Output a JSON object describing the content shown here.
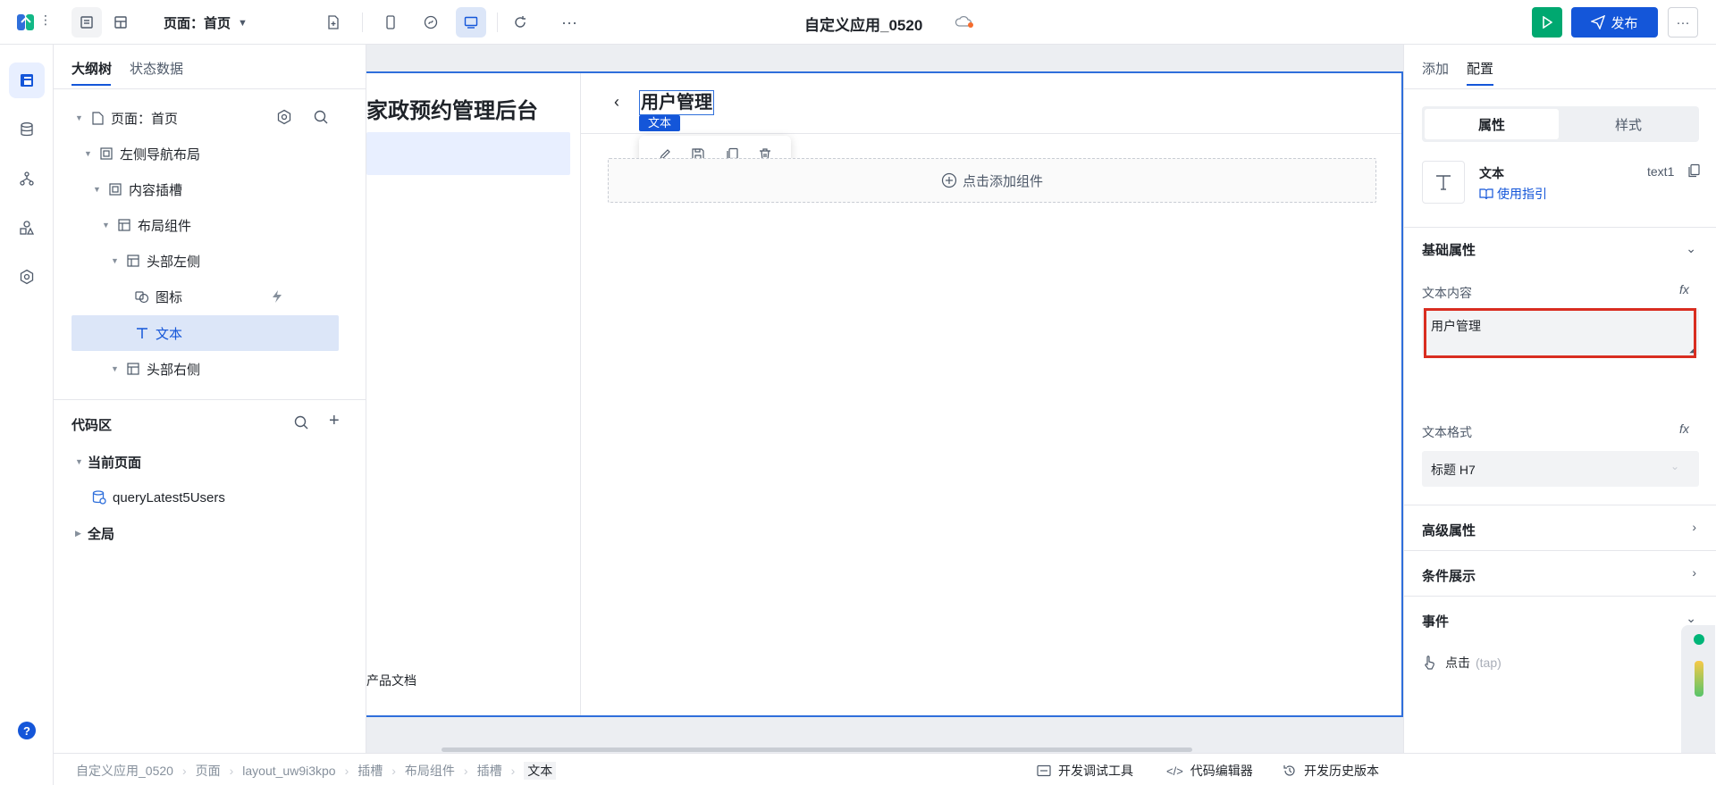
{
  "topbar": {
    "page_selector": "页面：首页",
    "app_title": "自定义应用_0520",
    "publish_label": "发布"
  },
  "outline": {
    "tabs": [
      "大纲树",
      "状态数据"
    ],
    "tree": [
      {
        "label": "页面：首页",
        "level": 0
      },
      {
        "label": "左侧导航布局",
        "level": 1
      },
      {
        "label": "内容插槽",
        "level": 2
      },
      {
        "label": "布局组件",
        "level": 3
      },
      {
        "label": "头部左侧",
        "level": 4
      },
      {
        "label": "图标",
        "level": 5
      },
      {
        "label": "文本",
        "level": 5
      },
      {
        "label": "头部右侧",
        "level": 4
      }
    ],
    "code_area": {
      "title": "代码区",
      "current_page": "当前页面",
      "query": "queryLatest5Users",
      "global": "全局"
    }
  },
  "canvas": {
    "sidebar_title": "家政预约管理后台",
    "sidebar_footer": "产品文档",
    "header_text": "用户管理",
    "selected_tag": "文本",
    "add_component": "点击添加组件"
  },
  "rightpanel": {
    "tabs": [
      "添加",
      "配置"
    ],
    "seg": [
      "属性",
      "样式"
    ],
    "component_name": "文本",
    "component_id": "text1",
    "guide_link": "使用指引",
    "basic_props": "基础属性",
    "text_content_label": "文本内容",
    "text_content_value": "用户管理",
    "text_format_label": "文本格式",
    "text_format_value": "标题 H7",
    "advanced_props": "高级属性",
    "conditional": "条件展示",
    "events": "事件",
    "event_tap": "点击",
    "event_tap_code": "(tap)",
    "fx": "fx"
  },
  "bottombar": {
    "breadcrumbs": [
      "自定义应用_0520",
      "页面",
      "layout_uw9i3kpo",
      "插槽",
      "布局组件",
      "插槽",
      "文本"
    ],
    "dev_tools": "开发调试工具",
    "code_editor": "代码编辑器",
    "history": "开发历史版本"
  },
  "colors": {
    "accent": "#1456d9",
    "run_green": "#00a870",
    "highlight_red": "#d92d20",
    "selected_row": "#dce6f8"
  }
}
